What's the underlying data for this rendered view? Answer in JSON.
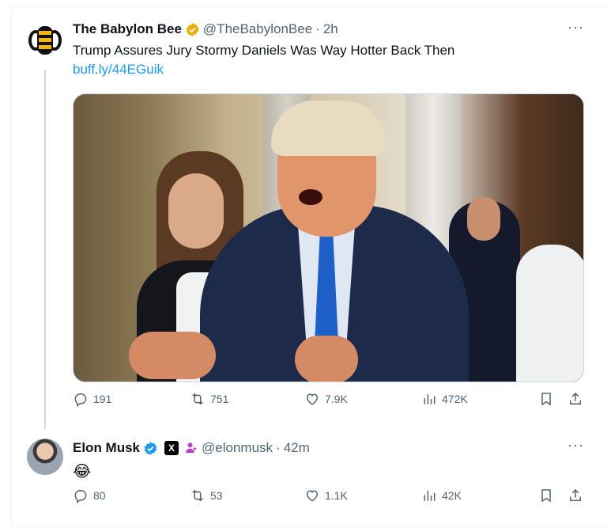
{
  "tweets": [
    {
      "display_name": "The Babylon Bee",
      "verified": "gold",
      "handle": "@TheBabylonBee",
      "separator": "·",
      "time": "2h",
      "text": "Trump Assures Jury Stormy Daniels Was Way Hotter Back Then",
      "link": "buff.ly/44EGuik",
      "more": "···",
      "stats": {
        "replies": "191",
        "reposts": "751",
        "likes": "7.9K",
        "views": "472K"
      }
    },
    {
      "display_name": "Elon Musk",
      "verified": "blue",
      "badge_label": "X",
      "handle": "@elonmusk",
      "separator": "·",
      "time": "42m",
      "text": "😂",
      "more": "···",
      "stats": {
        "replies": "80",
        "reposts": "53",
        "likes": "1.1K",
        "views": "42K"
      }
    }
  ],
  "icons": [
    "bee-logo-icon",
    "verified-icon",
    "more-icon",
    "reply-icon",
    "repost-icon",
    "like-icon",
    "views-icon",
    "bookmark-icon",
    "share-icon"
  ],
  "colors": {
    "link": "#1d9bf0",
    "muted": "#536471",
    "gold": "#f4b400",
    "blue_check": "#1d9bf0"
  }
}
